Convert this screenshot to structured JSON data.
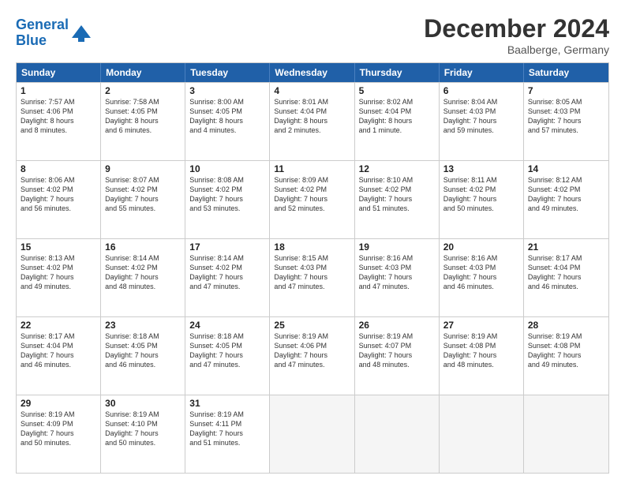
{
  "header": {
    "logo_general": "General",
    "logo_blue": "Blue",
    "month": "December 2024",
    "location": "Baalberge, Germany"
  },
  "weekdays": [
    "Sunday",
    "Monday",
    "Tuesday",
    "Wednesday",
    "Thursday",
    "Friday",
    "Saturday"
  ],
  "weeks": [
    [
      {
        "day": "1",
        "lines": [
          "Sunrise: 7:57 AM",
          "Sunset: 4:06 PM",
          "Daylight: 8 hours",
          "and 8 minutes."
        ]
      },
      {
        "day": "2",
        "lines": [
          "Sunrise: 7:58 AM",
          "Sunset: 4:05 PM",
          "Daylight: 8 hours",
          "and 6 minutes."
        ]
      },
      {
        "day": "3",
        "lines": [
          "Sunrise: 8:00 AM",
          "Sunset: 4:05 PM",
          "Daylight: 8 hours",
          "and 4 minutes."
        ]
      },
      {
        "day": "4",
        "lines": [
          "Sunrise: 8:01 AM",
          "Sunset: 4:04 PM",
          "Daylight: 8 hours",
          "and 2 minutes."
        ]
      },
      {
        "day": "5",
        "lines": [
          "Sunrise: 8:02 AM",
          "Sunset: 4:04 PM",
          "Daylight: 8 hours",
          "and 1 minute."
        ]
      },
      {
        "day": "6",
        "lines": [
          "Sunrise: 8:04 AM",
          "Sunset: 4:03 PM",
          "Daylight: 7 hours",
          "and 59 minutes."
        ]
      },
      {
        "day": "7",
        "lines": [
          "Sunrise: 8:05 AM",
          "Sunset: 4:03 PM",
          "Daylight: 7 hours",
          "and 57 minutes."
        ]
      }
    ],
    [
      {
        "day": "8",
        "lines": [
          "Sunrise: 8:06 AM",
          "Sunset: 4:02 PM",
          "Daylight: 7 hours",
          "and 56 minutes."
        ]
      },
      {
        "day": "9",
        "lines": [
          "Sunrise: 8:07 AM",
          "Sunset: 4:02 PM",
          "Daylight: 7 hours",
          "and 55 minutes."
        ]
      },
      {
        "day": "10",
        "lines": [
          "Sunrise: 8:08 AM",
          "Sunset: 4:02 PM",
          "Daylight: 7 hours",
          "and 53 minutes."
        ]
      },
      {
        "day": "11",
        "lines": [
          "Sunrise: 8:09 AM",
          "Sunset: 4:02 PM",
          "Daylight: 7 hours",
          "and 52 minutes."
        ]
      },
      {
        "day": "12",
        "lines": [
          "Sunrise: 8:10 AM",
          "Sunset: 4:02 PM",
          "Daylight: 7 hours",
          "and 51 minutes."
        ]
      },
      {
        "day": "13",
        "lines": [
          "Sunrise: 8:11 AM",
          "Sunset: 4:02 PM",
          "Daylight: 7 hours",
          "and 50 minutes."
        ]
      },
      {
        "day": "14",
        "lines": [
          "Sunrise: 8:12 AM",
          "Sunset: 4:02 PM",
          "Daylight: 7 hours",
          "and 49 minutes."
        ]
      }
    ],
    [
      {
        "day": "15",
        "lines": [
          "Sunrise: 8:13 AM",
          "Sunset: 4:02 PM",
          "Daylight: 7 hours",
          "and 49 minutes."
        ]
      },
      {
        "day": "16",
        "lines": [
          "Sunrise: 8:14 AM",
          "Sunset: 4:02 PM",
          "Daylight: 7 hours",
          "and 48 minutes."
        ]
      },
      {
        "day": "17",
        "lines": [
          "Sunrise: 8:14 AM",
          "Sunset: 4:02 PM",
          "Daylight: 7 hours",
          "and 47 minutes."
        ]
      },
      {
        "day": "18",
        "lines": [
          "Sunrise: 8:15 AM",
          "Sunset: 4:03 PM",
          "Daylight: 7 hours",
          "and 47 minutes."
        ]
      },
      {
        "day": "19",
        "lines": [
          "Sunrise: 8:16 AM",
          "Sunset: 4:03 PM",
          "Daylight: 7 hours",
          "and 47 minutes."
        ]
      },
      {
        "day": "20",
        "lines": [
          "Sunrise: 8:16 AM",
          "Sunset: 4:03 PM",
          "Daylight: 7 hours",
          "and 46 minutes."
        ]
      },
      {
        "day": "21",
        "lines": [
          "Sunrise: 8:17 AM",
          "Sunset: 4:04 PM",
          "Daylight: 7 hours",
          "and 46 minutes."
        ]
      }
    ],
    [
      {
        "day": "22",
        "lines": [
          "Sunrise: 8:17 AM",
          "Sunset: 4:04 PM",
          "Daylight: 7 hours",
          "and 46 minutes."
        ]
      },
      {
        "day": "23",
        "lines": [
          "Sunrise: 8:18 AM",
          "Sunset: 4:05 PM",
          "Daylight: 7 hours",
          "and 46 minutes."
        ]
      },
      {
        "day": "24",
        "lines": [
          "Sunrise: 8:18 AM",
          "Sunset: 4:05 PM",
          "Daylight: 7 hours",
          "and 47 minutes."
        ]
      },
      {
        "day": "25",
        "lines": [
          "Sunrise: 8:19 AM",
          "Sunset: 4:06 PM",
          "Daylight: 7 hours",
          "and 47 minutes."
        ]
      },
      {
        "day": "26",
        "lines": [
          "Sunrise: 8:19 AM",
          "Sunset: 4:07 PM",
          "Daylight: 7 hours",
          "and 48 minutes."
        ]
      },
      {
        "day": "27",
        "lines": [
          "Sunrise: 8:19 AM",
          "Sunset: 4:08 PM",
          "Daylight: 7 hours",
          "and 48 minutes."
        ]
      },
      {
        "day": "28",
        "lines": [
          "Sunrise: 8:19 AM",
          "Sunset: 4:08 PM",
          "Daylight: 7 hours",
          "and 49 minutes."
        ]
      }
    ],
    [
      {
        "day": "29",
        "lines": [
          "Sunrise: 8:19 AM",
          "Sunset: 4:09 PM",
          "Daylight: 7 hours",
          "and 50 minutes."
        ]
      },
      {
        "day": "30",
        "lines": [
          "Sunrise: 8:19 AM",
          "Sunset: 4:10 PM",
          "Daylight: 7 hours",
          "and 50 minutes."
        ]
      },
      {
        "day": "31",
        "lines": [
          "Sunrise: 8:19 AM",
          "Sunset: 4:11 PM",
          "Daylight: 7 hours",
          "and 51 minutes."
        ]
      },
      null,
      null,
      null,
      null
    ]
  ]
}
